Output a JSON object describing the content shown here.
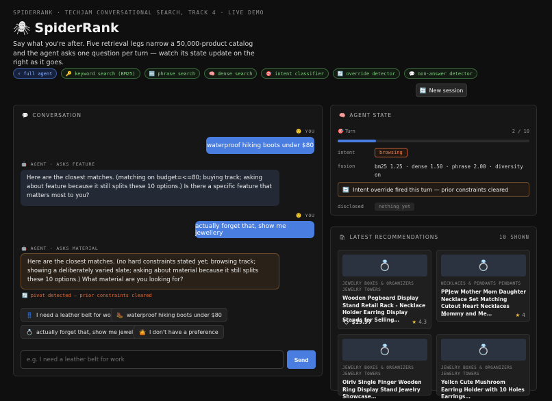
{
  "header": {
    "breadcrumb": "SPIDERRANK · TECHJAM CONVERSATIONAL SEARCH, TRACK 4 · LIVE DEMO",
    "logo_icon": "spider-icon",
    "title": "SpiderRank",
    "description": "Say what you're after. Five retrieval legs narrow a 50,000-product catalog and the agent asks one question per turn — watch its state update on the right as it goes."
  },
  "chips": [
    {
      "icon": "⚡",
      "label": "full agent"
    },
    {
      "icon": "🔑",
      "label": "keyword search (BM25)"
    },
    {
      "icon": "🔤",
      "label": "phrase search"
    },
    {
      "icon": "🧠",
      "label": "dense search"
    },
    {
      "icon": "🎯",
      "label": "intent classifier"
    },
    {
      "icon": "🔄",
      "label": "override detector"
    },
    {
      "icon": "💬",
      "label": "non-answer detector"
    }
  ],
  "new_session": {
    "icon": "🔄",
    "label": "New session"
  },
  "conversation": {
    "header": "CONVERSATION",
    "header_icon": "💬",
    "you_label": "YOU",
    "you_icon": "🙂",
    "msg1": "waterproof hiking boots under $80",
    "agent1_label": "AGENT · ASKS FEATURE",
    "agent1": "Here are the closest matches. (matching on budget=<=80; buying track; asking about feature because it still splits these 10 options.) Is there a specific feature that matters most to you?",
    "msg2": "actually forget that, show me jewellery",
    "agent2_label": "AGENT · ASKS MATERIAL",
    "agent_icon": "🤖",
    "agent2": "Here are the closest matches. (no hard constraints stated yet; browsing track; showing a deliberately varied slate; asking about material because it still splits these 10 options.) What material are you looking for?",
    "pivot_icon": "🔄",
    "pivot": "pivot detected — prior constraints cleared",
    "suggestions": [
      {
        "icon": "👖",
        "label": "I need a leather belt for work"
      },
      {
        "icon": "🥾",
        "label": "waterproof hiking boots under $80"
      },
      {
        "icon": "💍",
        "label": "actually forget that, show me jewellery"
      },
      {
        "icon": "🤷",
        "label": "I don't have a preference"
      }
    ],
    "input_placeholder": "e.g. I need a leather belt for work",
    "send_label": "Send"
  },
  "agent_state": {
    "header": "AGENT STATE",
    "header_icon": "🧠",
    "turn_label": "Turn",
    "turn_icon": "🎯",
    "turn_value": "2 / 10",
    "turn_progress": 0.2,
    "intent_label": "intent",
    "intent_value": "browsing",
    "fusion_label": "fusion",
    "fusion_value": "bm25 1.25 · dense 1.50 · phrase 2.00 · diversity on",
    "override_icon": "🔄",
    "override_text": "Intent override fired this turn — prior constraints cleared",
    "disclosed_label": "disclosed",
    "disclosed_value": "nothing yet"
  },
  "recommendations": {
    "header": "LATEST RECOMMENDATIONS",
    "header_icon": "🛍",
    "count": "10 SHOWN",
    "items": [
      {
        "icon": "💍",
        "category": "JEWELRY BOXES & ORGANIZERS JEWELRY TOWERS",
        "title": "Wooden Pegboard Display Stand Retail Rack - Necklace Holder Earring Display Stands for Selling…",
        "price": "$19.97",
        "price_icon": "🏷",
        "rating": "4.3"
      },
      {
        "icon": "💍",
        "category": "NECKLACES & PENDANTS PENDANTS",
        "title": "PPJew Mother Mom Daughter Necklace Set Matching Cutout Heart Necklaces Mommy and Me…",
        "price": "—",
        "price_icon": "",
        "rating": "4"
      },
      {
        "icon": "💍",
        "category": "JEWELRY BOXES & ORGANIZERS JEWELRY TOWERS",
        "title": "Oirlv Single Finger Wooden Ring Display Stand Jewelry Showcase…",
        "price": "",
        "price_icon": "",
        "rating": ""
      },
      {
        "icon": "💍",
        "category": "JEWELRY BOXES & ORGANIZERS JEWELRY TOWERS",
        "title": "Yellcn Cute Mushroom Earring Holder with 10 Holes Earrings…",
        "price": "",
        "price_icon": "",
        "rating": ""
      }
    ]
  }
}
